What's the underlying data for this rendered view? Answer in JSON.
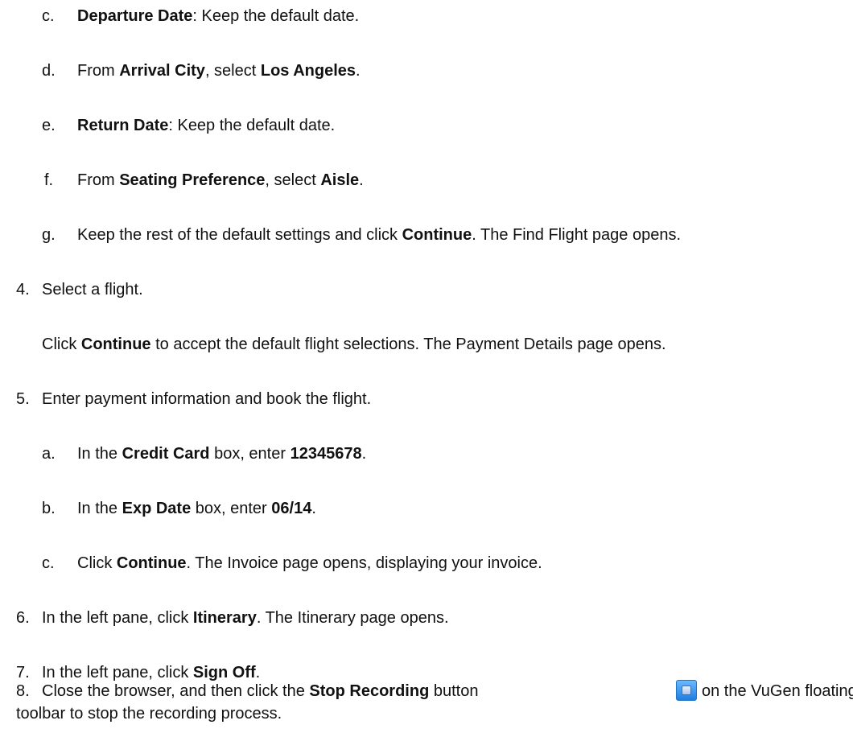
{
  "steps": [
    {
      "label": "c.",
      "parts": [
        {
          "t": "Departure Date",
          "b": true
        },
        {
          "t": ": Keep the default date.",
          "b": false
        }
      ]
    },
    {
      "label": "d.",
      "parts": [
        {
          "t": "From ",
          "b": false
        },
        {
          "t": "Arrival City",
          "b": true
        },
        {
          "t": ", select ",
          "b": false
        },
        {
          "t": "Los Angeles",
          "b": true
        },
        {
          "t": ".",
          "b": false
        }
      ]
    },
    {
      "label": "e.",
      "parts": [
        {
          "t": "Return Date",
          "b": true
        },
        {
          "t": ": Keep the default date.",
          "b": false
        }
      ]
    },
    {
      "label": "f.",
      "parts": [
        {
          "t": "From ",
          "b": false
        },
        {
          "t": "Seating Preference",
          "b": true
        },
        {
          "t": ", select ",
          "b": false
        },
        {
          "t": "Aisle",
          "b": true
        },
        {
          "t": ".",
          "b": false
        }
      ]
    },
    {
      "label": "g.",
      "parts": [
        {
          "t": "Keep the rest of the default settings and click ",
          "b": false
        },
        {
          "t": "Continue",
          "b": true
        },
        {
          "t": ". The Find Flight page opens.",
          "b": false
        }
      ]
    },
    {
      "label": "4.",
      "parts": [
        {
          "t": "Select a flight.",
          "b": false
        }
      ]
    },
    {
      "label": "",
      "parts": [
        {
          "t": "Click ",
          "b": false
        },
        {
          "t": "Continue",
          "b": true
        },
        {
          "t": " to accept the default flight selections. The Payment Details page opens.",
          "b": false
        }
      ]
    },
    {
      "label": "5.",
      "parts": [
        {
          "t": "Enter payment information and book the flight.",
          "b": false
        }
      ]
    },
    {
      "label": "a.",
      "parts": [
        {
          "t": "In the ",
          "b": false
        },
        {
          "t": "Credit Card",
          "b": true
        },
        {
          "t": " box, enter ",
          "b": false
        },
        {
          "t": "12345678",
          "b": true
        },
        {
          "t": ".",
          "b": false
        }
      ]
    },
    {
      "label": "b.",
      "parts": [
        {
          "t": "In the ",
          "b": false
        },
        {
          "t": "Exp Date",
          "b": true
        },
        {
          "t": " box, enter ",
          "b": false
        },
        {
          "t": "06/14",
          "b": true
        },
        {
          "t": ".",
          "b": false
        }
      ]
    },
    {
      "label": "c.",
      "parts": [
        {
          "t": "Click ",
          "b": false
        },
        {
          "t": "Continue",
          "b": true
        },
        {
          "t": ". The Invoice page opens, displaying your invoice.",
          "b": false
        }
      ]
    },
    {
      "label": "6.",
      "parts": [
        {
          "t": "In the left pane, click ",
          "b": false
        },
        {
          "t": "Itinerary",
          "b": true
        },
        {
          "t": ". The Itinerary page opens.",
          "b": false
        }
      ]
    },
    {
      "label": "7.",
      "parts": [
        {
          "t": "In the left pane, click ",
          "b": false
        },
        {
          "t": "Sign Off",
          "b": true
        },
        {
          "t": ".",
          "b": false
        }
      ]
    },
    {
      "label": "8.",
      "parts": [
        {
          "t": "Close the browser, and then click the ",
          "b": false
        },
        {
          "t": "Stop Recording",
          "b": true
        },
        {
          "t": " button ",
          "b": false
        }
      ]
    },
    {
      "label": "",
      "parts": [
        {
          "t": " on the VuGen floating",
          "b": false
        }
      ]
    },
    {
      "label": "",
      "parts": [
        {
          "t": "toolbar to stop the recording process.",
          "b": false
        }
      ]
    }
  ],
  "icon": "stop-recording-icon"
}
